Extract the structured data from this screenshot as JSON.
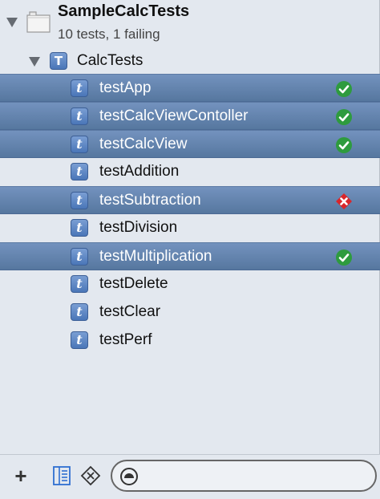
{
  "project": {
    "title": "SampleCalcTests",
    "subtitle": "10 tests, 1 failing"
  },
  "target": {
    "icon_letter": "T",
    "label": "CalcTests"
  },
  "tests": [
    {
      "label": "testApp",
      "icon_letter": "t",
      "status": "passed",
      "selected": true
    },
    {
      "label": "testCalcViewContoller",
      "icon_letter": "t",
      "status": "passed",
      "selected": true
    },
    {
      "label": "testCalcView",
      "icon_letter": "t",
      "status": "passed",
      "selected": true
    },
    {
      "label": "testAddition",
      "icon_letter": "t",
      "status": "none",
      "selected": false
    },
    {
      "label": "testSubtraction",
      "icon_letter": "t",
      "status": "failed",
      "selected": true
    },
    {
      "label": "testDivision",
      "icon_letter": "t",
      "status": "none",
      "selected": false
    },
    {
      "label": "testMultiplication",
      "icon_letter": "t",
      "status": "passed",
      "selected": true
    },
    {
      "label": "testDelete",
      "icon_letter": "t",
      "status": "none",
      "selected": false
    },
    {
      "label": "testClear",
      "icon_letter": "t",
      "status": "none",
      "selected": false
    },
    {
      "label": "testPerf",
      "icon_letter": "t",
      "status": "none",
      "selected": false
    }
  ],
  "bottom_bar": {
    "add_label": "+",
    "icons": [
      "filter-list-icon",
      "filter-status-icon",
      "search-icon"
    ]
  },
  "colors": {
    "passed": "#2e9b3e",
    "failed": "#d9252a",
    "selection": "#6486b4",
    "test_icon": "#5a84c2"
  }
}
